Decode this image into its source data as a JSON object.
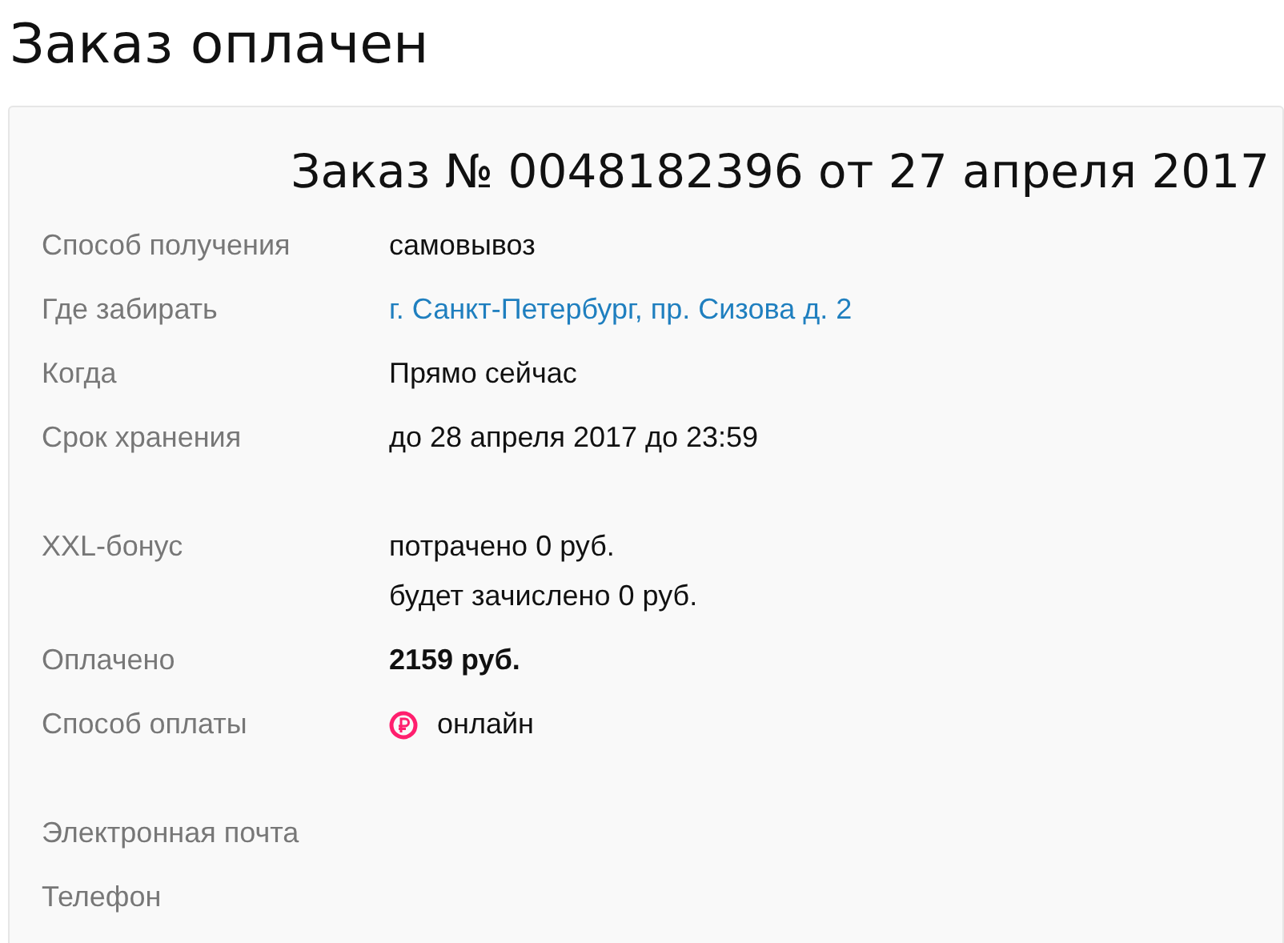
{
  "page_title": "Заказ оплачен",
  "order": {
    "heading": "Заказ № 0048182396 от 27 апреля 2017",
    "groups": [
      {
        "rows": [
          {
            "label": "Способ получения",
            "kind": "text",
            "values": [
              "самовывоз"
            ]
          },
          {
            "label": "Где забирать",
            "kind": "link",
            "values": [
              "г. Санкт-Петербург, пр. Сизова д. 2"
            ]
          },
          {
            "label": "Когда",
            "kind": "text",
            "values": [
              "Прямо сейчас"
            ]
          },
          {
            "label": "Срок хранения",
            "kind": "text",
            "values": [
              "до 28 апреля 2017 до 23:59"
            ]
          }
        ]
      },
      {
        "rows": [
          {
            "label": "XXL-бонус",
            "kind": "text",
            "values": [
              "потрачено 0 руб.",
              "будет зачислено 0 руб."
            ]
          },
          {
            "label": "Оплачено",
            "kind": "bold",
            "values": [
              "2159 руб."
            ]
          },
          {
            "label": "Способ оплаты",
            "kind": "payment",
            "values": [
              "онлайн"
            ]
          }
        ]
      },
      {
        "rows": [
          {
            "label": "Электронная почта"
          },
          {
            "label": "Телефон"
          }
        ]
      }
    ]
  }
}
